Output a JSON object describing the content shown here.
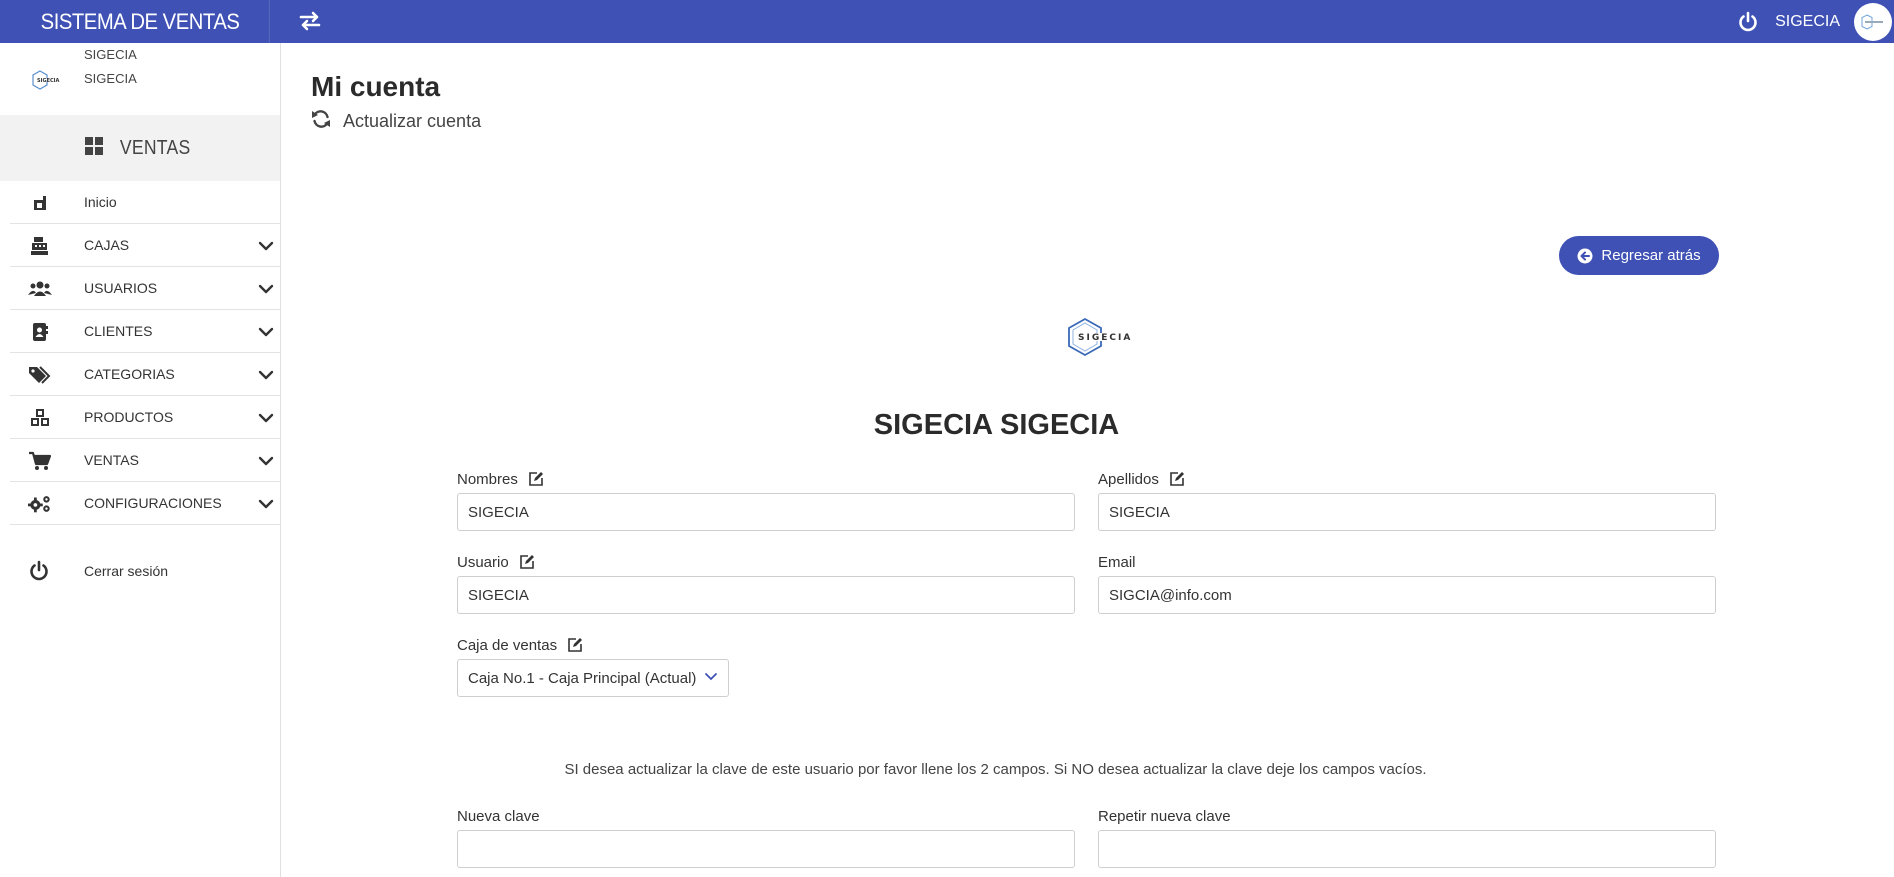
{
  "topbar": {
    "brand": "SISTEMA DE VENTAS",
    "user": "SIGECIA",
    "accent": "#3f51b5"
  },
  "sidebar": {
    "profile": {
      "line1": "SIGECIA",
      "line2": "SIGECIA",
      "logo_icon": "sigecia-logo"
    },
    "section": {
      "label": "VENTAS",
      "icon": "grid-icon"
    },
    "items": [
      {
        "label": "Inicio",
        "icon": "home-icon",
        "has_children": false
      },
      {
        "label": "CAJAS",
        "icon": "cash-register-icon",
        "has_children": true
      },
      {
        "label": "USUARIOS",
        "icon": "users-icon",
        "has_children": true
      },
      {
        "label": "CLIENTES",
        "icon": "address-book-icon",
        "has_children": true
      },
      {
        "label": "CATEGORIAS",
        "icon": "tags-icon",
        "has_children": true
      },
      {
        "label": "PRODUCTOS",
        "icon": "cubes-icon",
        "has_children": true
      },
      {
        "label": "VENTAS",
        "icon": "cart-icon",
        "has_children": true
      },
      {
        "label": "CONFIGURACIONES",
        "icon": "gears-icon",
        "has_children": true
      }
    ],
    "logout": {
      "label": "Cerrar sesión",
      "icon": "power-icon"
    }
  },
  "main": {
    "title": "Mi cuenta",
    "refresh_label": "Actualizar cuenta",
    "back_label": "Regresar atrás",
    "user_name": "SIGECIA SIGECIA",
    "form": {
      "nombres": {
        "label": "Nombres",
        "value": "SIGECIA"
      },
      "apellidos": {
        "label": "Apellidos",
        "value": "SIGECIA"
      },
      "usuario": {
        "label": "Usuario",
        "value": "SIGECIA"
      },
      "email": {
        "label": "Email",
        "value": "SIGCIA@info.com"
      },
      "caja": {
        "label": "Caja de ventas",
        "selected": "Caja No.1 - Caja Principal (Actual)"
      },
      "notice": "SI desea actualizar la clave de este usuario por favor llene los 2 campos. Si NO desea actualizar la clave deje los campos vacíos.",
      "nueva_clave": {
        "label": "Nueva clave",
        "value": ""
      },
      "repetir_clave": {
        "label": "Repetir nueva clave",
        "value": ""
      }
    }
  }
}
